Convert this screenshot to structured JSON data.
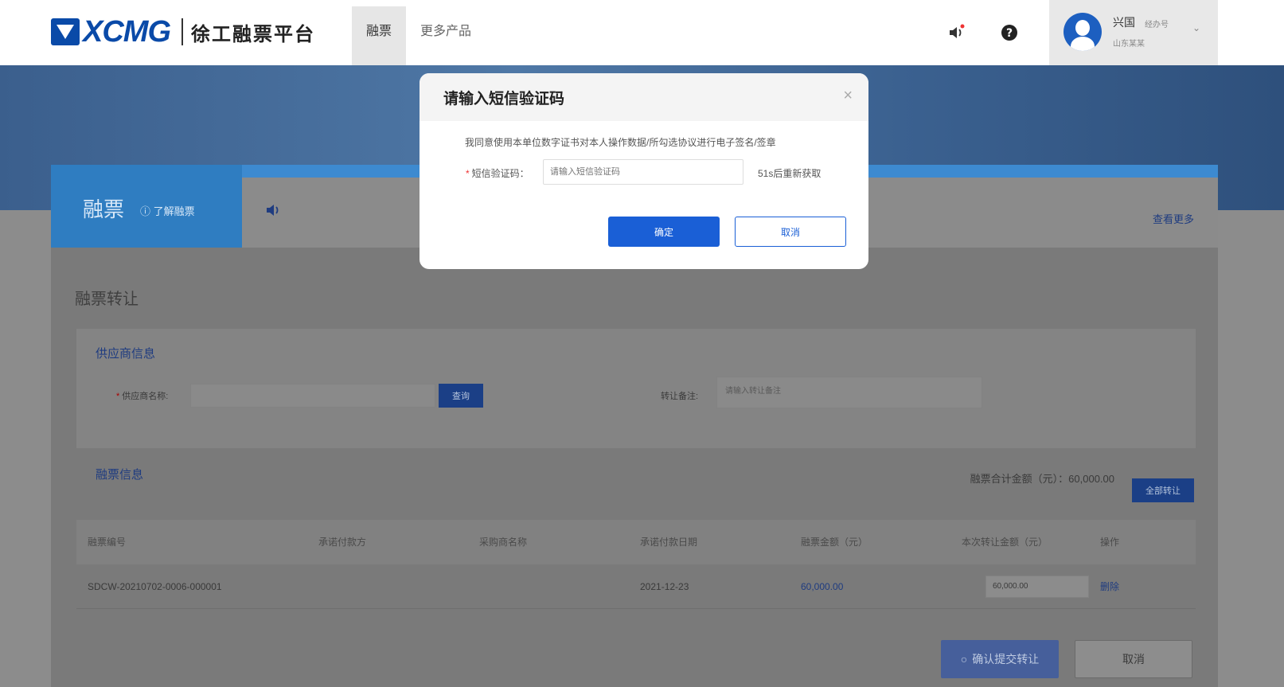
{
  "header": {
    "brand": "XCMG",
    "platform_name": "徐工融票平台",
    "nav": [
      {
        "label": "融票",
        "active": true
      },
      {
        "label": "更多产品",
        "active": false
      }
    ],
    "user": {
      "name": "兴国",
      "role": "经办号",
      "org": "山东某某"
    }
  },
  "card": {
    "tab_title": "融票",
    "tab_help": "了解融票",
    "more_link": "查看更多"
  },
  "page": {
    "section_title": "融票转让",
    "supplier": {
      "title": "供应商信息",
      "name_label": "供应商名称:",
      "query_button": "查询",
      "remark_label": "转让备注:",
      "remark_placeholder": "请输入转让备注"
    },
    "finance": {
      "title": "融票信息",
      "total_label": "融票合计金额（元）：",
      "total_value": "60,000.00",
      "transfer_all": "全部转让"
    },
    "table": {
      "headers": [
        "融票编号",
        "承诺付款方",
        "采购商名称",
        "承诺付款日期",
        "融票金额（元）",
        "本次转让金额（元）",
        "操作"
      ],
      "rows": [
        {
          "id": "SDCW-20210702-0006-000001",
          "payer": "",
          "buyer": "",
          "date": "2021-12-23",
          "amount": "60,000.00",
          "transfer_amount": "60,000.00",
          "action": "删除"
        }
      ]
    },
    "confirm_button": "确认提交转让",
    "cancel_button": "取消"
  },
  "modal": {
    "title": "请输入短信验证码",
    "consent": "我同意使用本单位数字证书对本人操作数据/所勾选协议进行电子签名/签章",
    "sms_label": "短信验证码：",
    "sms_placeholder": "请输入短信验证码",
    "countdown": "51s后重新获取",
    "ok": "确定",
    "cancel": "取消"
  },
  "colors": {
    "primary": "#1a5fd6",
    "brand": "#0a4aa8",
    "overlay_bg": "#8c8c8c"
  }
}
